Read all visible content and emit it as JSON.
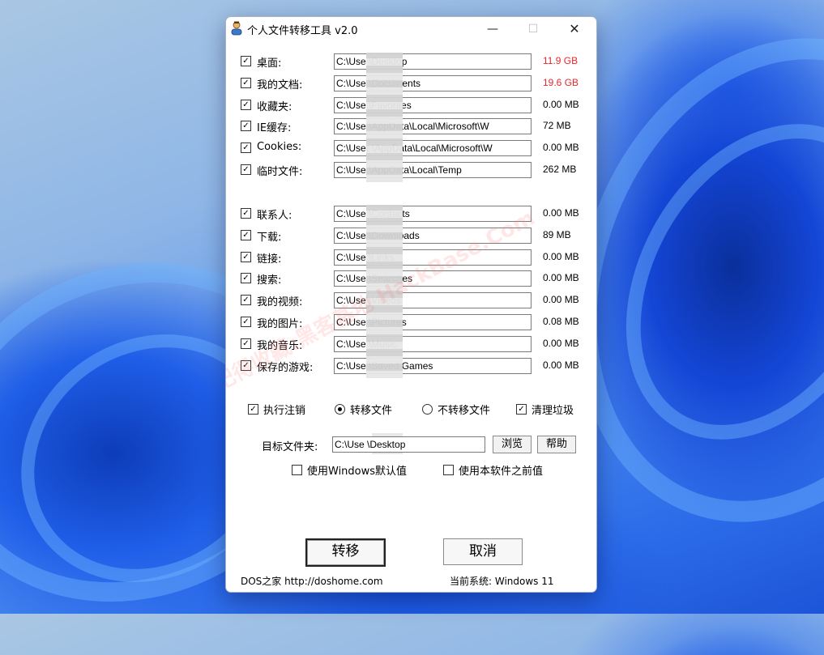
{
  "window": {
    "title": "个人文件转移工具 v2.0",
    "controls": {
      "minimize": "—",
      "maximize": "☐",
      "close": "✕"
    }
  },
  "folders_group1": [
    {
      "label": "桌面:",
      "path": "C:\\Use          \\Desktop",
      "size": "11.9 GB",
      "checked": true,
      "highlight": true
    },
    {
      "label": "我的文档:",
      "path": "C:\\Use          \\Documents",
      "size": "19.6 GB",
      "checked": true,
      "highlight": true
    },
    {
      "label": "收藏夹:",
      "path": "C:\\Use          \\Favorites",
      "size": "0.00 MB",
      "checked": true,
      "highlight": false
    },
    {
      "label": "IE缓存:",
      "path": "C:\\Use          \\AppData\\Local\\Microsoft\\W",
      "size": "72  MB",
      "checked": true,
      "highlight": false
    },
    {
      "label": "Cookies:",
      "path": "C:\\User          \\AppData\\Local\\Microsoft\\W",
      "size": "0.00 MB",
      "checked": true,
      "highlight": false
    },
    {
      "label": "临时文件:",
      "path": "C:\\Use          \\AppData\\Local\\Temp",
      "size": "262  MB",
      "checked": true,
      "highlight": false
    }
  ],
  "folders_group2": [
    {
      "label": "联系人:",
      "path": "C:\\Use          \\Contacts",
      "size": "0.00 MB",
      "checked": true
    },
    {
      "label": "下载:",
      "path": "C:\\Use          \\Downloads",
      "size": "89  MB",
      "checked": true
    },
    {
      "label": "链接:",
      "path": "C:\\Use          \\Links",
      "size": "0.00 MB",
      "checked": true
    },
    {
      "label": "搜索:",
      "path": "C:\\Use          \\Searches",
      "size": "0.00 MB",
      "checked": true
    },
    {
      "label": "我的视频:",
      "path": "C:\\Use          \\Videos",
      "size": "0.00 MB",
      "checked": true
    },
    {
      "label": "我的图片:",
      "path": "C:\\Use          \\Pictures",
      "size": "0.08 MB",
      "checked": true
    },
    {
      "label": "我的音乐:",
      "path": "C:\\Use          \\Music",
      "size": "0.00 MB",
      "checked": true
    },
    {
      "label": "保存的游戏:",
      "path": "C:\\Use          \\Saved Games",
      "size": "0.00 MB",
      "checked": true
    }
  ],
  "options": {
    "logoff": {
      "label": "执行注销",
      "checked": true
    },
    "move_files": {
      "label": "转移文件",
      "selected": true
    },
    "no_move_files": {
      "label": "不转移文件",
      "selected": false
    },
    "clean_junk": {
      "label": "清理垃圾",
      "checked": true
    }
  },
  "target": {
    "label": "目标文件夹:",
    "path": "C:\\Use          \\Desktop",
    "browse_label": "浏览",
    "help_label": "帮助"
  },
  "defaults": {
    "windows_default": {
      "label": "使用Windows默认值",
      "checked": false
    },
    "previous_value": {
      "label": "使用本软件之前值",
      "checked": false
    }
  },
  "actions": {
    "transfer_label": "转移",
    "cancel_label": "取消"
  },
  "footer": {
    "site": "DOS之家 http://doshome.com",
    "system": "当前系统:  Windows 11"
  },
  "watermark": "记得收藏:黑客基地  HackBase.Com",
  "colors": {
    "size_highlight": "#e8272a",
    "accent": "#1d55d8"
  }
}
